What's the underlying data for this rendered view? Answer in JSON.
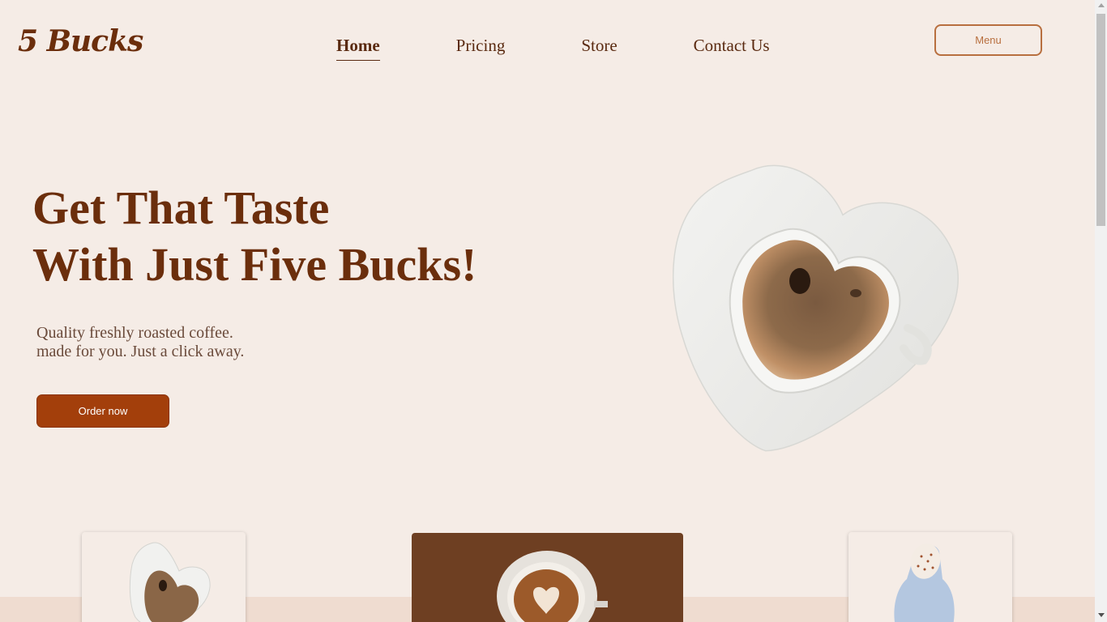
{
  "header": {
    "logo": "5 Bucks",
    "nav": [
      {
        "label": "Home",
        "active": true
      },
      {
        "label": "Pricing",
        "active": false
      },
      {
        "label": "Store",
        "active": false
      },
      {
        "label": "Contact Us",
        "active": false
      }
    ],
    "menu_button": "Menu"
  },
  "hero": {
    "title_line1": "Get That Taste",
    "title_line2": "With Just Five Bucks!",
    "subtitle_line1": "Quality freshly roasted coffee.",
    "subtitle_line2": "made for you. Just a click away.",
    "cta": "Order now"
  },
  "products": [
    {
      "image": "heart-cup-image"
    },
    {
      "image": "latte-art-image"
    },
    {
      "image": "blue-mug-image"
    }
  ],
  "colors": {
    "background": "#f5ece6",
    "brand_brown": "#6b2e0c",
    "cta": "#a33f0b",
    "menu_border": "#b86f3f",
    "band": "#efdcd0",
    "featured_card": "#6e3f22"
  }
}
